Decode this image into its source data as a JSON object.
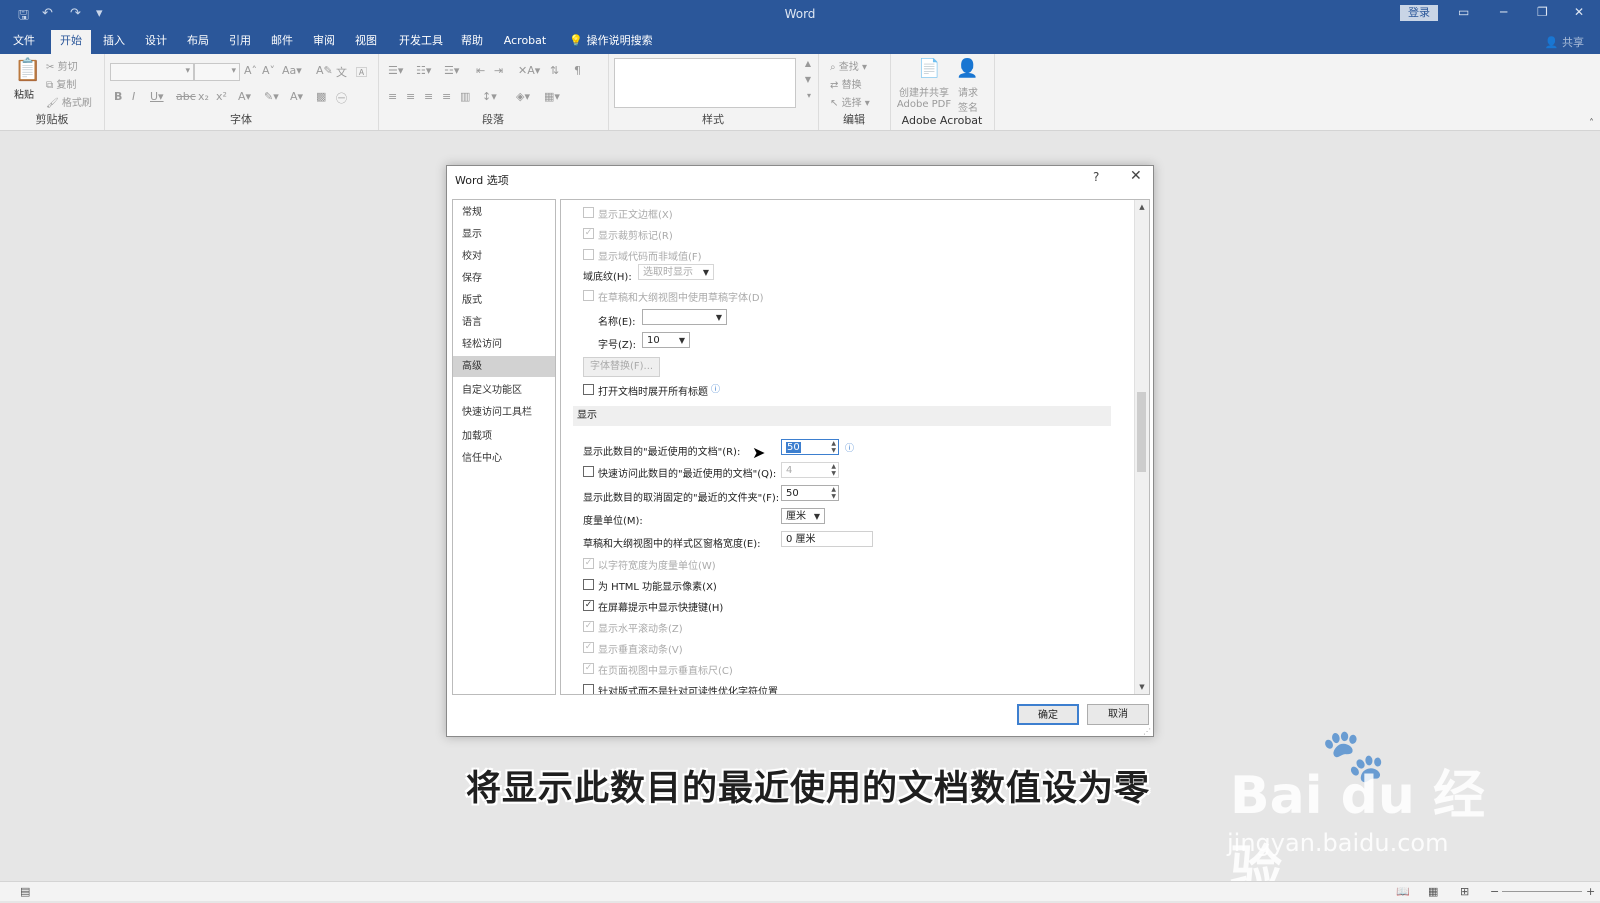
{
  "app": {
    "window_title": "Word",
    "login_label": "登录",
    "share_label": "共享",
    "qa_save_icon": "save-icon",
    "qa_undo_icon": "undo-icon",
    "qa_redo_icon": "redo-icon"
  },
  "tabs": [
    {
      "label": "文件"
    },
    {
      "label": "开始"
    },
    {
      "label": "插入"
    },
    {
      "label": "设计"
    },
    {
      "label": "布局"
    },
    {
      "label": "引用"
    },
    {
      "label": "邮件"
    },
    {
      "label": "审阅"
    },
    {
      "label": "视图"
    },
    {
      "label": "开发工具"
    },
    {
      "label": "帮助"
    },
    {
      "label": "Acrobat"
    },
    {
      "label": "操作说明搜索"
    }
  ],
  "ribbon": {
    "clipboard": {
      "label": "剪贴板",
      "paste": "粘贴",
      "cut": "剪切",
      "copy": "复制",
      "format_painter": "格式刷"
    },
    "font": {
      "label": "字体"
    },
    "paragraph": {
      "label": "段落"
    },
    "styles": {
      "label": "样式"
    },
    "editing": {
      "label": "编辑",
      "find": "查找",
      "replace": "替换",
      "select": "选择"
    },
    "acrobat": {
      "label": "Adobe Acrobat",
      "create_pdf_1": "创建并共享",
      "create_pdf_2": "Adobe PDF",
      "request_sig_1": "请求",
      "request_sig_2": "签名"
    }
  },
  "dialog": {
    "title": "Word 选项",
    "help": "?",
    "close": "✕",
    "nav": [
      {
        "label": "常规"
      },
      {
        "label": "显示"
      },
      {
        "label": "校对"
      },
      {
        "label": "保存"
      },
      {
        "label": "版式"
      },
      {
        "label": "语言"
      },
      {
        "label": "轻松访问"
      },
      {
        "label": "高级"
      },
      {
        "label": "自定义功能区"
      },
      {
        "label": "快速访问工具栏"
      },
      {
        "label": "加载项"
      },
      {
        "label": "信任中心"
      }
    ],
    "content": {
      "show_text_boundaries": "显示正文边框(X)",
      "show_crop_marks": "显示裁剪标记(R)",
      "show_field_codes": "显示域代码而非域值(F)",
      "field_shading_label": "域底纹(H):",
      "field_shading_value": "选取时显示",
      "draft_font": "在草稿和大纲视图中使用草稿字体(D)",
      "name_label": "名称(E):",
      "name_value": "",
      "size_label": "字号(Z):",
      "size_value": "10",
      "font_substitution": "字体替换(F)...",
      "expand_headings": "打开文档时展开所有标题",
      "display_section": "显示",
      "recent_docs_label": "显示此数目的\"最近使用的文档\"(R):",
      "recent_docs_value": "50",
      "quick_access_label": "快速访问此数目的\"最近使用的文档\"(Q):",
      "quick_access_value": "4",
      "recent_folders_label": "显示此数目的取消固定的\"最近的文件夹\"(F):",
      "recent_folders_value": "50",
      "units_label": "度量单位(M):",
      "units_value": "厘米",
      "style_area_label": "草稿和大纲视图中的样式区窗格宽度(E):",
      "style_area_value": "0 厘米",
      "char_width_units": "以字符宽度为度量单位(W)",
      "html_pixels": "为 HTML 功能显示像素(X)",
      "shortcut_tips": "在屏幕提示中显示快捷键(H)",
      "horizontal_scroll": "显示水平滚动条(Z)",
      "vertical_scroll": "显示垂直滚动条(V)",
      "vertical_ruler": "在页面视图中显示垂直标尺(C)",
      "optimize_layout": "针对版式而不是针对可读性优化字符位置"
    },
    "ok": "确定",
    "cancel": "取消"
  },
  "caption": "将显示此数目的最近使用的文档数值设为零",
  "watermark": {
    "brand": "Bai du 经验",
    "url": "jingyan.baidu.com"
  },
  "colors": {
    "title_bar": "#2b579a",
    "accent": "#3d7fcf"
  }
}
